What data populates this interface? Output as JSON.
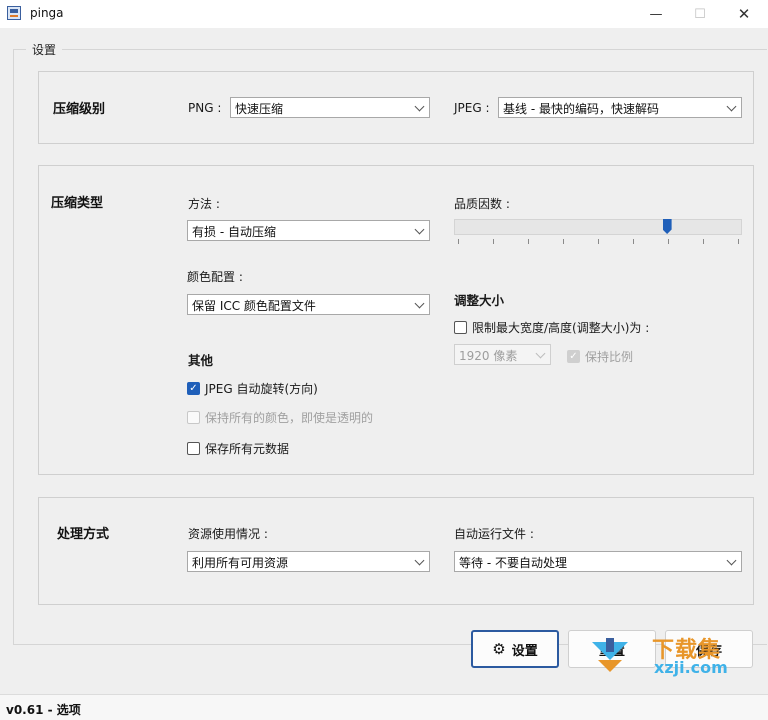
{
  "window": {
    "title": "pinga",
    "minimize": "—",
    "maximize": "☐",
    "close": "✕"
  },
  "settings": {
    "group_title": "设置",
    "compression_level": {
      "section": "压缩级别",
      "png_label": "PNG :",
      "png_value": "快速压缩",
      "jpeg_label": "JPEG :",
      "jpeg_value": "基线 - 最快的编码，快速解码"
    },
    "compression_type": {
      "section": "压缩类型",
      "method_label": "方法 :",
      "method_value": "有损 - 自动压缩",
      "quality_label": "品质因数 :",
      "quality_level": 0.74,
      "color_profile_label": "颜色配置 :",
      "color_profile_value": "保留 ICC 颜色配置文件",
      "resize_title": "调整大小",
      "resize_limit_label": "限制最大宽度/高度(调整大小)为 :",
      "resize_limit_checked": false,
      "resize_size_value": "1920 像素",
      "keep_ratio_label": "保持比例",
      "keep_ratio_checked": true,
      "other_title": "其他",
      "jpeg_rotate_label": "JPEG 自动旋转(方向)",
      "jpeg_rotate_checked": true,
      "keep_colors_label": "保持所有的颜色，即使是透明的",
      "keep_colors_checked": false,
      "keep_metadata_label": "保存所有元数据",
      "keep_metadata_checked": false
    },
    "processing": {
      "section": "处理方式",
      "resource_label": "资源使用情况 :",
      "resource_value": "利用所有可用资源",
      "auto_run_label": "自动运行文件 :",
      "auto_run_value": "等待 - 不要自动处理"
    }
  },
  "buttons": {
    "settings": "设置",
    "reset": "重置",
    "save": "保存"
  },
  "status": {
    "text": "v0.61 - 选项"
  },
  "watermark": {
    "text": "下载集",
    "sub": "xzji.com"
  }
}
